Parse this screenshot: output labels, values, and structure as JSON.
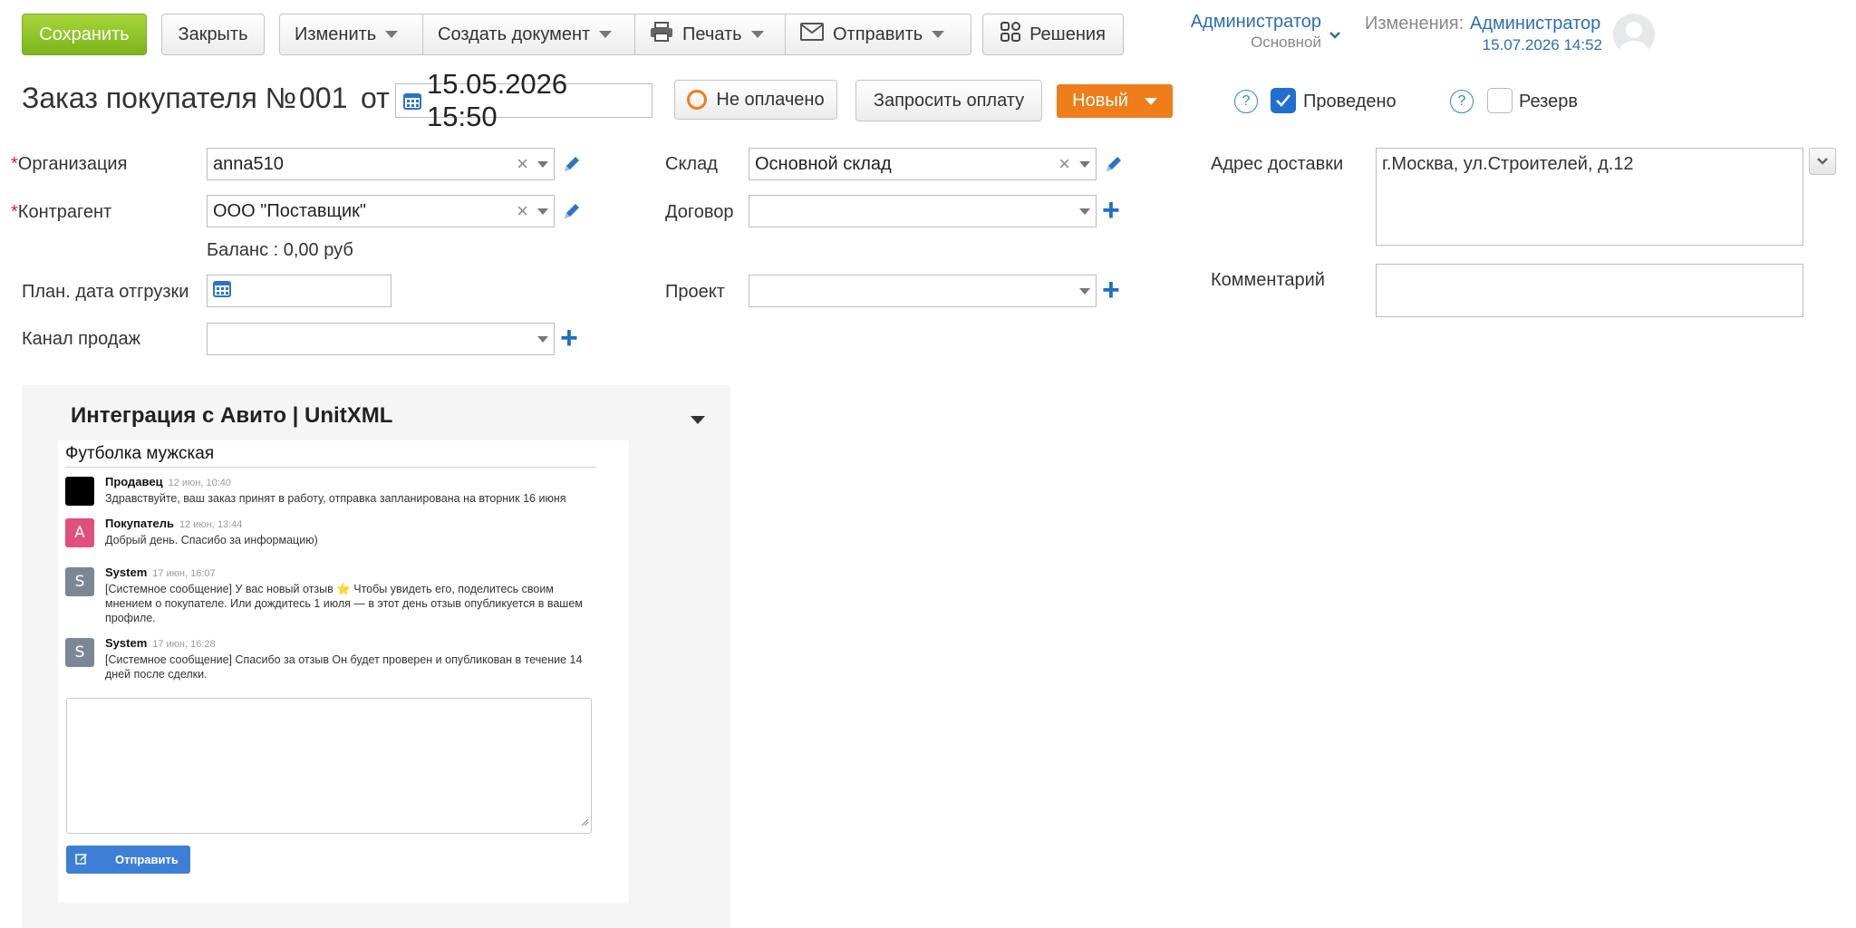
{
  "toolbar": {
    "save": "Сохранить",
    "close": "Закрыть",
    "edit": "Изменить",
    "create_doc": "Создать документ",
    "print": "Печать",
    "send": "Отправить",
    "solutions": "Решения"
  },
  "user": {
    "name": "Администратор",
    "role": "Основной",
    "changes_label": "Изменения:",
    "changes_by": "Администратор",
    "changes_date": "15.07.2026 14:52"
  },
  "order": {
    "title": "Заказ покупателя №",
    "number": "001",
    "from_label": "от",
    "date": "15.05.2026 15:50",
    "payment_status": "Не оплачено",
    "request_payment": "Запросить оплату",
    "status": "Новый",
    "posted_label": "Проведено",
    "posted_checked": true,
    "reserve_label": "Резерв",
    "reserve_checked": false
  },
  "form": {
    "organization_label": "Организация",
    "organization_value": "anna510",
    "counterparty_label": "Контрагент",
    "counterparty_value": "ООО \"Поставщик\"",
    "balance": "Баланс : 0,00 руб",
    "ship_date_label": "План. дата отгрузки",
    "ship_date_value": "",
    "sales_channel_label": "Канал продаж",
    "sales_channel_value": "",
    "warehouse_label": "Склад",
    "warehouse_value": "Основной склад",
    "contract_label": "Договор",
    "contract_value": "",
    "project_label": "Проект",
    "project_value": "",
    "delivery_address_label": "Адрес доставки",
    "delivery_address_value": "г.Москва, ул.Строителей, д.12",
    "comment_label": "Комментарий",
    "comment_value": ""
  },
  "integration": {
    "title": "Интеграция с Авито | UnitXML",
    "chat_title": "Футболка мужская",
    "messages": [
      {
        "avatar": "",
        "avatar_color": "#000000",
        "author": "Продавец",
        "time": "12 июн, 10:40",
        "text": "Здравствуйте, ваш заказ принят в работу, отправка запланирована на вторник 16 июня"
      },
      {
        "avatar": "А",
        "avatar_color": "#e0507a",
        "author": "Покупатель",
        "time": "12 июн, 13:44",
        "text": "Добрый день. Спасибо за информацию)"
      },
      {
        "avatar": "S",
        "avatar_color": "#7b8794",
        "author": "System",
        "time": "17 июн, 16:07",
        "text": "[Системное сообщение] У вас новый отзыв ⭐ Чтобы увидеть его, поделитесь своим мнением о покупателе. Или дождитесь 1 июля — в этот день отзыв опубликуется в вашем профиле."
      },
      {
        "avatar": "S",
        "avatar_color": "#7b8794",
        "author": "System",
        "time": "17 июн, 16:28",
        "text": "[Системное сообщение] Спасибо за отзыв Он будет проверен и опубликован в течение 14 дней после сделки."
      }
    ],
    "reply_value": "",
    "send_button": "Отправить"
  },
  "colors": {
    "save_green": "#8cc227",
    "status_orange": "#ef7d1a",
    "link_blue": "#2c6eb5",
    "checkbox_blue": "#1f6fd1",
    "send_blue": "#3d7fd6"
  }
}
